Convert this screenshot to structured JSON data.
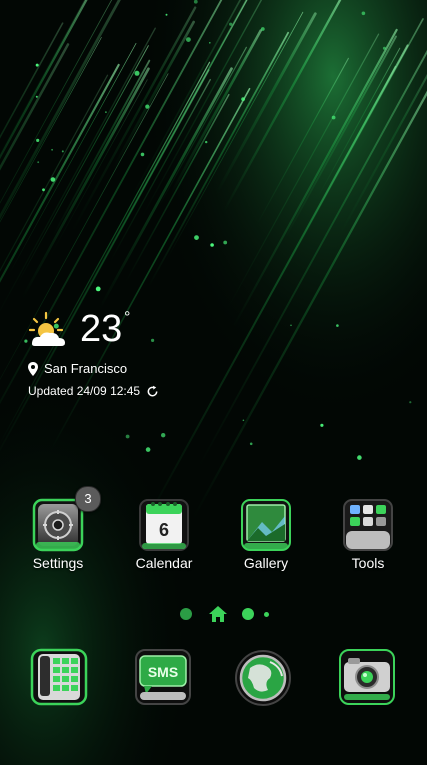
{
  "weather": {
    "temperature": "23",
    "degree_symbol": "°",
    "location": "San Francisco",
    "updated": "Updated 24/09 12:45",
    "icon": "partly-sunny-icon"
  },
  "apps": [
    {
      "label": "Settings",
      "icon": "settings-gear-icon",
      "badge": "3"
    },
    {
      "label": "Calendar",
      "icon": "calendar-icon",
      "day": "6"
    },
    {
      "label": "Gallery",
      "icon": "gallery-icon"
    },
    {
      "label": "Tools",
      "icon": "tools-folder-icon"
    }
  ],
  "dock": [
    {
      "icon": "phone-icon"
    },
    {
      "icon": "sms-icon",
      "text": "SMS"
    },
    {
      "icon": "browser-globe-icon"
    },
    {
      "icon": "camera-icon"
    }
  ],
  "page_indicator": {
    "pages": 3,
    "home_icon": "home-icon"
  },
  "colors": {
    "accent": "#3ddc5a",
    "background": "#020704"
  }
}
